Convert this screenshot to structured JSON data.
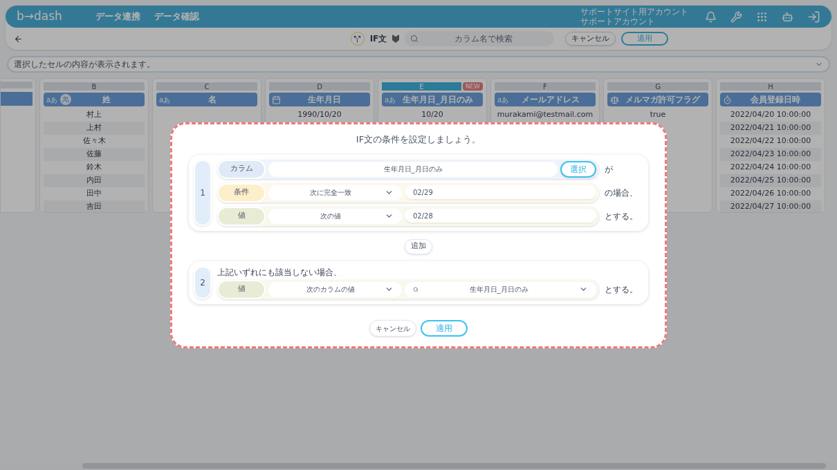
{
  "header": {
    "logo": "b→dash",
    "nav": [
      "データ連携",
      "データ確認"
    ],
    "account": [
      "サポートサイト用アカウント",
      "サポートアカウント"
    ]
  },
  "toolbar": {
    "title": "IF文",
    "search": {
      "placeholder": "カラム名で検索"
    },
    "cancel": "キャンセル",
    "apply": "適用"
  },
  "cell_viewer": {
    "placeholder": "選択したセルの内容が表示されます。"
  },
  "table": {
    "columns": [
      {
        "letter": "B",
        "name": "姓",
        "kind": "text_group",
        "type_label": "aあ",
        "highlighted": false,
        "cells": [
          "村上",
          "上村",
          "佐々木",
          "佐藤",
          "鈴木",
          "内田",
          "田中",
          "吉田"
        ]
      },
      {
        "letter": "C",
        "name": "名",
        "kind": "text",
        "type_label": "aあ",
        "highlighted": false
      },
      {
        "letter": "D",
        "name": "生年月日",
        "kind": "date",
        "highlighted": false,
        "cells": [
          "1990/10/20"
        ]
      },
      {
        "letter": "E",
        "name": "生年月日_月日のみ",
        "kind": "text",
        "type_label": "aあ",
        "highlighted": true,
        "badge": "NEW",
        "cells": [
          "10/20"
        ]
      },
      {
        "letter": "F",
        "name": "メールアドレス",
        "kind": "text",
        "type_label": "aあ",
        "highlighted": false,
        "cells": [
          "murakami@testmail.com"
        ]
      },
      {
        "letter": "G",
        "name": "メルマガ許可フラグ",
        "kind": "flag",
        "highlighted": false,
        "cells": [
          "true"
        ]
      },
      {
        "letter": "H",
        "name": "会員登録日時",
        "kind": "datetime",
        "highlighted": false,
        "cells": [
          "2022/04/20 10:00:00",
          "2022/04/21 10:00:00",
          "2022/04/22 10:00:00",
          "2022/04/23 10:00:00",
          "2022/04/24 10:00:00",
          "2022/04/25 10:00:00",
          "2022/04/26 10:00:00",
          "2022/04/27 10:00:00"
        ]
      }
    ]
  },
  "dialog": {
    "title": "IF文の条件を設定しましょう。",
    "rules": [
      {
        "number": "1",
        "rows": [
          {
            "kind": "column",
            "label": "カラム",
            "value": "生年月日_月日のみ",
            "button": "選択",
            "suffix": "が"
          },
          {
            "kind": "condition",
            "label": "条件",
            "select": "次に完全一致",
            "value": "02/29",
            "suffix": "の場合、"
          },
          {
            "kind": "value",
            "label": "値",
            "select": "次の値",
            "value": "02/28",
            "suffix": "とする。"
          }
        ]
      },
      {
        "number": "2",
        "note": "上記いずれにも該当しない場合、",
        "rows": [
          {
            "kind": "value_column",
            "label": "値",
            "select": "次のカラムの値",
            "value": "生年月日_月日のみ",
            "suffix": "とする。"
          }
        ]
      }
    ],
    "add": "追加",
    "cancel": "キャンセル",
    "apply": "適用"
  }
}
